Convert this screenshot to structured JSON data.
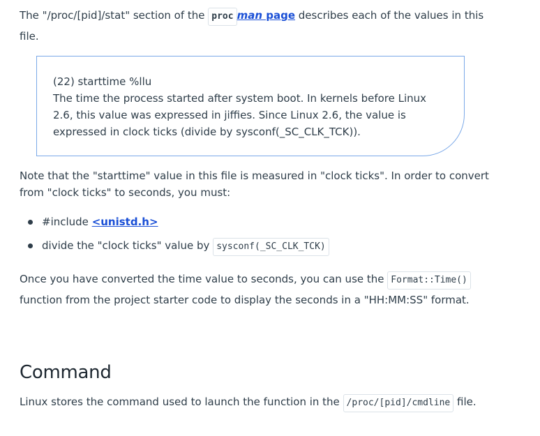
{
  "intro": {
    "text_before": "The \"/proc/[pid]/stat\" section of the ",
    "code": "proc",
    "link_em": "man",
    "link_rest": " page",
    "text_after": " describes each of the values in this file."
  },
  "quote": {
    "heading": "(22) starttime %llu",
    "body": "The time the process started after system boot. In kernels before Linux 2.6, this value was expressed in jiffies. Since Linux 2.6, the value is expressed in clock ticks (divide by sysconf(_SC_CLK_TCK))."
  },
  "note": {
    "text": "Note that the \"starttime\" value in this file is measured in \"clock ticks\". In order to convert from \"clock ticks\" to seconds, you must:"
  },
  "steps": {
    "item1_prefix": "#include ",
    "item1_link": "<unistd.h>",
    "item2_prefix": "divide the \"clock ticks\" value by ",
    "item2_code": "sysconf(_SC_CLK_TCK)"
  },
  "convert": {
    "text_before": "Once you have converted the time value to seconds, you can use the ",
    "code": "Format::Time()",
    "text_after": " function from the project starter code to display the seconds in a \"HH:MM:SS\" format."
  },
  "command_section": {
    "heading": "Command",
    "text_before": "Linux stores the command used to launch the function in the ",
    "code": "/proc/[pid]/cmdline",
    "text_after": " file."
  }
}
